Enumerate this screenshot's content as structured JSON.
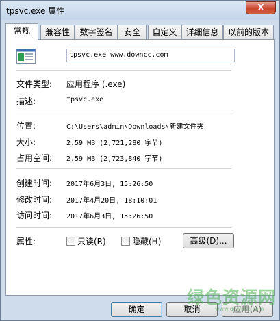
{
  "window": {
    "title": "tpsvc.exe 属性",
    "close_glyph": "X"
  },
  "tabs": [
    {
      "label": "常规",
      "active": true
    },
    {
      "label": "兼容性"
    },
    {
      "label": "数字签名"
    },
    {
      "label": "安全"
    },
    {
      "label": "自定义"
    },
    {
      "label": "详细信息"
    },
    {
      "label": "以前的版本"
    }
  ],
  "general": {
    "file_icon": "exe-file-icon",
    "file_name": "tpsvc.exe  www.downcc.com",
    "type_label": "文件类型:",
    "type_value": "应用程序 (.exe)",
    "desc_label": "描述:",
    "desc_value": "tpsvc.exe",
    "location_label": "位置:",
    "location_value": "C:\\Users\\admin\\Downloads\\新建文件夹",
    "size_label": "大小:",
    "size_value": "2.59 MB (2,721,280 字节)",
    "disk_size_label": "占用空间:",
    "disk_size_value": "2.59 MB (2,723,840 字节)",
    "created_label": "创建时间:",
    "created_value": "2017年6月3日, 15:26:50",
    "modified_label": "修改时间:",
    "modified_value": "2017年4月20日, 18:10:01",
    "accessed_label": "访问时间:",
    "accessed_value": "2017年6月3日, 15:26:50",
    "attributes_label": "属性:",
    "readonly_label": "只读(R)",
    "hidden_label": "隐藏(H)",
    "advanced_label": "高级(D)..."
  },
  "footer": {
    "ok_label": "确定",
    "cancel_label": "取消",
    "apply_label": "应用(A)"
  },
  "watermark": {
    "text": "绿色资源网",
    "sub": "www.downcc.com"
  }
}
